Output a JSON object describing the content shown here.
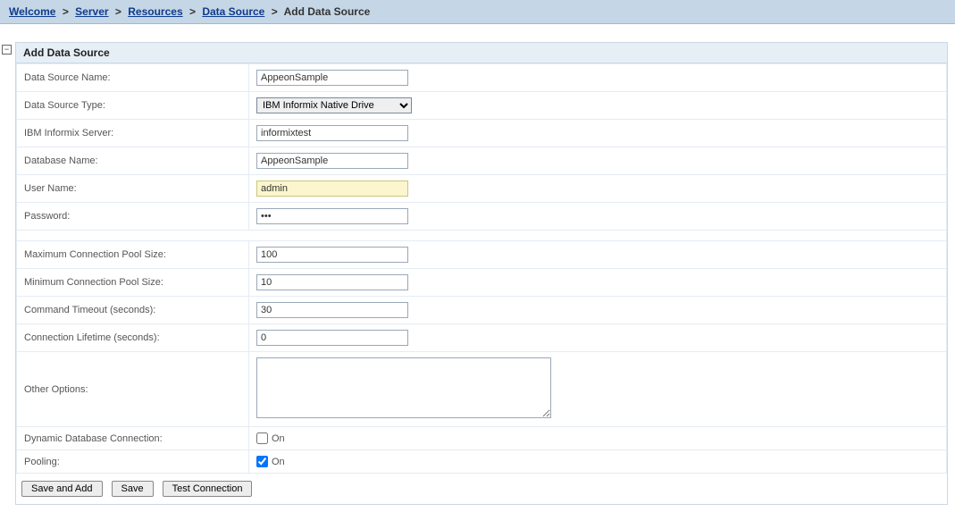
{
  "breadcrumb": {
    "items": [
      {
        "label": "Welcome",
        "link": true
      },
      {
        "label": "Server",
        "link": true
      },
      {
        "label": "Resources",
        "link": true
      },
      {
        "label": "Data Source",
        "link": true
      },
      {
        "label": "Add Data Source",
        "link": false
      }
    ]
  },
  "panel": {
    "title": "Add Data Source"
  },
  "fields": {
    "dataSourceName": {
      "label": "Data Source Name:",
      "value": "AppeonSample"
    },
    "dataSourceType": {
      "label": "Data Source Type:",
      "value": "IBM Informix Native Drive"
    },
    "informixServer": {
      "label": "IBM Informix Server:",
      "value": "informixtest"
    },
    "databaseName": {
      "label": "Database Name:",
      "value": "AppeonSample"
    },
    "userName": {
      "label": "User Name:",
      "value": "admin"
    },
    "password": {
      "label": "Password:",
      "value": "•••"
    },
    "maxPool": {
      "label": "Maximum Connection Pool Size:",
      "value": "100"
    },
    "minPool": {
      "label": "Minimum Connection Pool Size:",
      "value": "10"
    },
    "cmdTimeout": {
      "label": "Command Timeout (seconds):",
      "value": "30"
    },
    "connLifetime": {
      "label": "Connection Lifetime (seconds):",
      "value": "0"
    },
    "otherOptions": {
      "label": "Other Options:",
      "value": ""
    },
    "dynamicConn": {
      "label": "Dynamic Database Connection:",
      "checkLabel": "On",
      "checked": false
    },
    "pooling": {
      "label": "Pooling:",
      "checkLabel": "On",
      "checked": true
    }
  },
  "buttons": {
    "saveAndAdd": "Save and Add",
    "save": "Save",
    "testConnection": "Test Connection"
  },
  "icons": {
    "collapse": "⊟"
  }
}
